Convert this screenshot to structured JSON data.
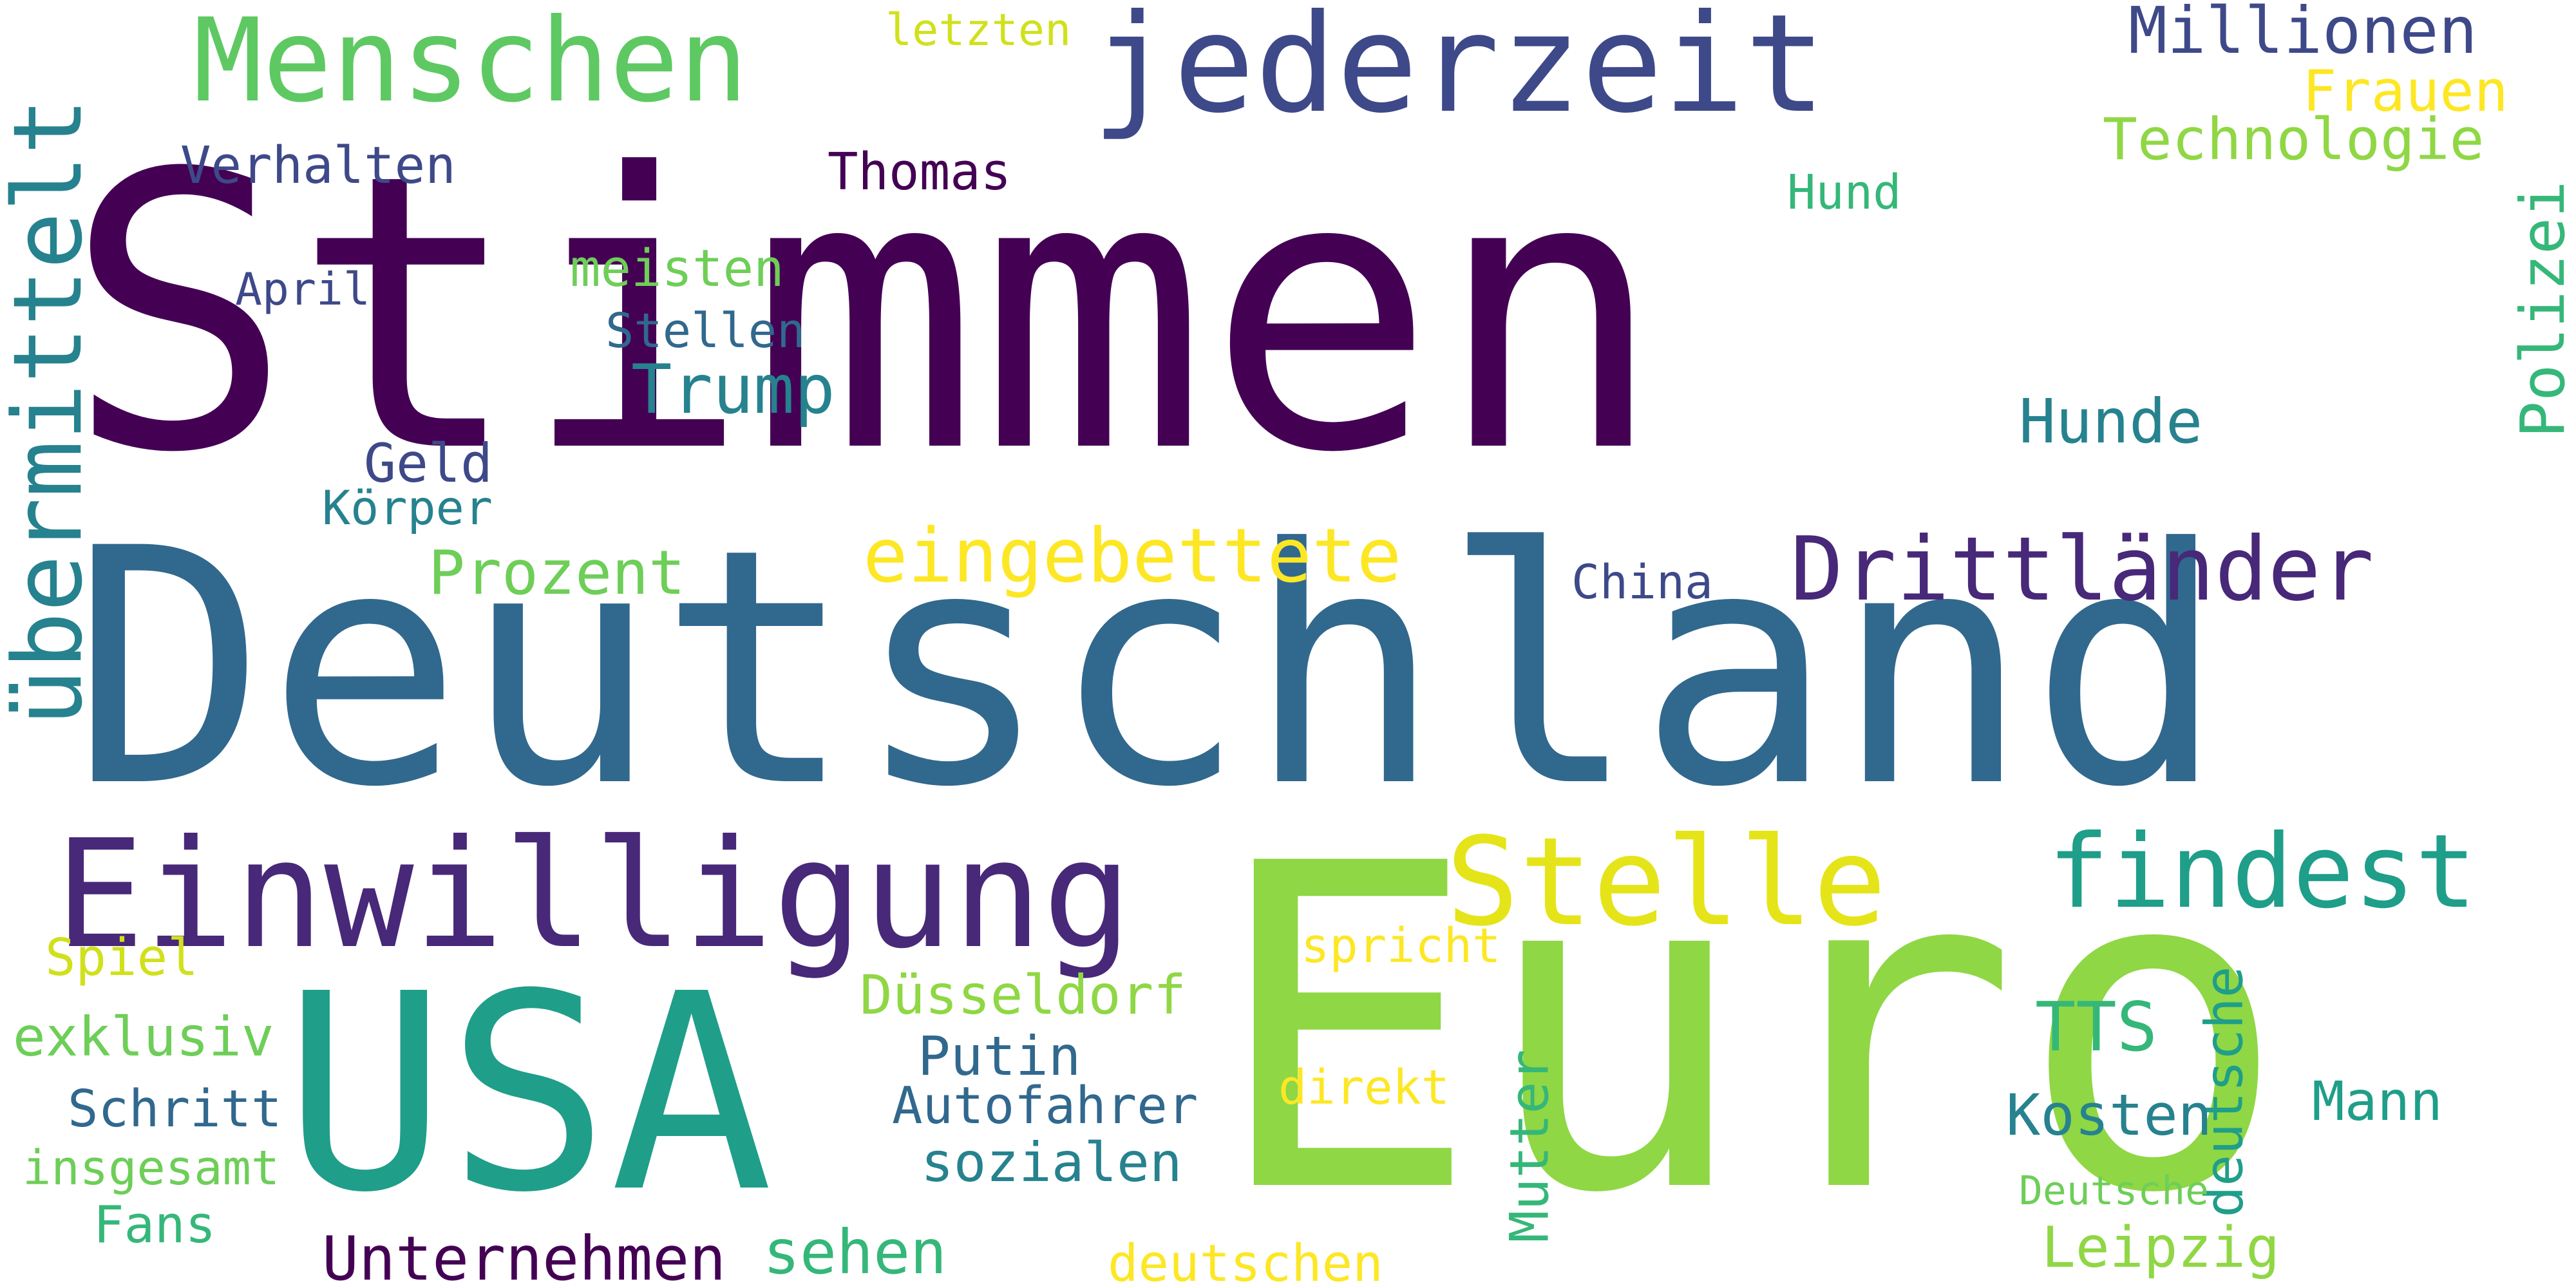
{
  "colors": {
    "background": "#ffffff",
    "palette": {
      "dark_purple": "#440154",
      "purple": "#482878",
      "indigo": "#3e4989",
      "blue": "#31688e",
      "teal_blue": "#26828e",
      "teal": "#1f9e89",
      "green": "#35b779",
      "light_green": "#6ece58",
      "lime": "#8fd744",
      "yellow_green": "#b5de2b",
      "yellow": "#fde725"
    }
  },
  "words": [
    {
      "text": "Stimmen",
      "color": "#440154"
    },
    {
      "text": "Deutschland",
      "color": "#31688e"
    },
    {
      "text": "Euro",
      "color": "#8fd744"
    },
    {
      "text": "USA",
      "color": "#1f9e89"
    },
    {
      "text": "jederzeit",
      "color": "#3e4989"
    },
    {
      "text": "Menschen",
      "color": "#5ec962"
    },
    {
      "text": "Einwilligung",
      "color": "#482878"
    },
    {
      "text": "Stelle",
      "color": "#e5e419"
    },
    {
      "text": "findest",
      "color": "#1f9e89"
    },
    {
      "text": "Drittländer",
      "color": "#482878"
    },
    {
      "text": "übermittelt",
      "color": "#26828e"
    },
    {
      "text": "eingebettete",
      "color": "#fde725"
    },
    {
      "text": "Polizei",
      "color": "#35b779"
    },
    {
      "text": "Millionen",
      "color": "#3e4989"
    },
    {
      "text": "Frauen",
      "color": "#fde725"
    },
    {
      "text": "Technologie",
      "color": "#8fd744"
    },
    {
      "text": "letzten",
      "color": "#d0e11c"
    },
    {
      "text": "Verhalten",
      "color": "#3e4989"
    },
    {
      "text": "Thomas",
      "color": "#440154"
    },
    {
      "text": "Hund",
      "color": "#35b779"
    },
    {
      "text": "meisten",
      "color": "#6ece58"
    },
    {
      "text": "April",
      "color": "#3e4989"
    },
    {
      "text": "Stellen",
      "color": "#31688e"
    },
    {
      "text": "Trump",
      "color": "#26828e"
    },
    {
      "text": "Hunde",
      "color": "#26828e"
    },
    {
      "text": "Geld",
      "color": "#3e4989"
    },
    {
      "text": "Körper",
      "color": "#26828e"
    },
    {
      "text": "Prozent",
      "color": "#6ece58"
    },
    {
      "text": "China",
      "color": "#3e4989"
    },
    {
      "text": "Spiel",
      "color": "#d0e11c"
    },
    {
      "text": "spricht",
      "color": "#fde725"
    },
    {
      "text": "Düsseldorf",
      "color": "#8fd744"
    },
    {
      "text": "exklusiv",
      "color": "#6ece58"
    },
    {
      "text": "TTS",
      "color": "#35b779"
    },
    {
      "text": "Putin",
      "color": "#31688e"
    },
    {
      "text": "deutsche",
      "color": "#1f9e89"
    },
    {
      "text": "Schritt",
      "color": "#31688e"
    },
    {
      "text": "Autofahrer",
      "color": "#31688e"
    },
    {
      "text": "direkt",
      "color": "#fde725"
    },
    {
      "text": "Mann",
      "color": "#1f9e89"
    },
    {
      "text": "Kosten",
      "color": "#26828e"
    },
    {
      "text": "insgesamt",
      "color": "#6ece58"
    },
    {
      "text": "sozialen",
      "color": "#26828e"
    },
    {
      "text": "Mutter",
      "color": "#35b779"
    },
    {
      "text": "Deutsche",
      "color": "#6ece58"
    },
    {
      "text": "Fans",
      "color": "#35b779"
    },
    {
      "text": "Unternehmen",
      "color": "#440154"
    },
    {
      "text": "sehen",
      "color": "#35b779"
    },
    {
      "text": "deutschen",
      "color": "#fde725"
    },
    {
      "text": "Leipzig",
      "color": "#8fd744"
    }
  ]
}
